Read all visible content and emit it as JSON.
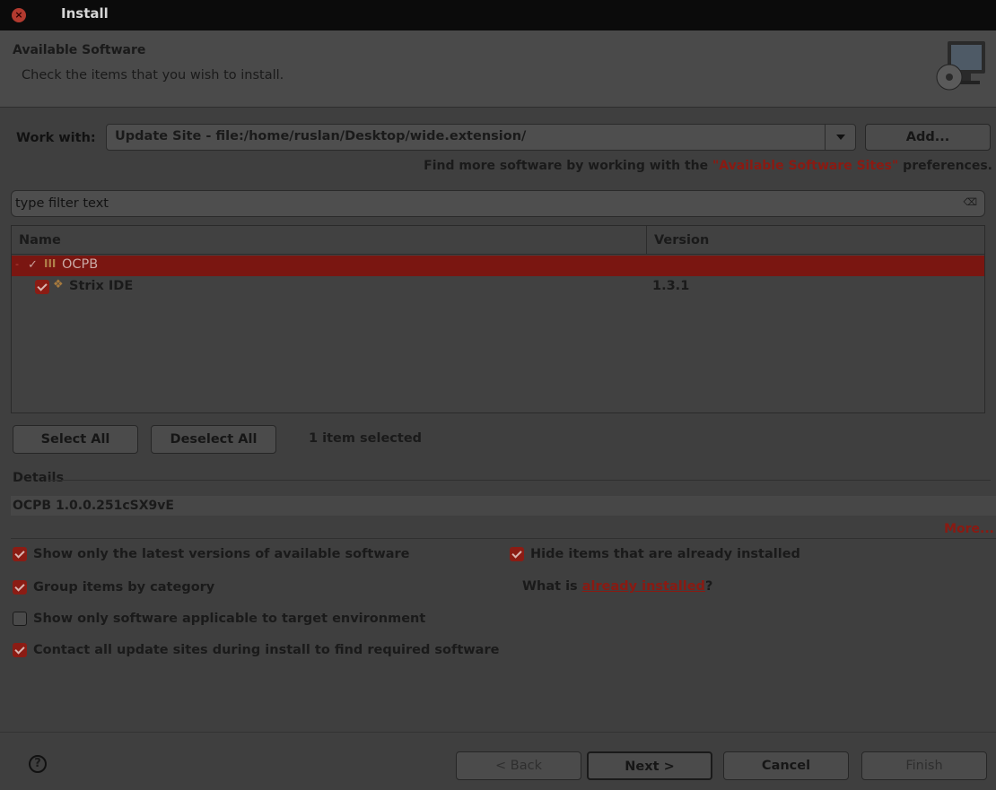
{
  "window": {
    "title": "Install"
  },
  "banner": {
    "title": "Available Software",
    "description": "Check the items that you wish to install."
  },
  "workwith": {
    "label": "Work with:",
    "value": "Update Site - file:/home/ruslan/Desktop/wide.extension/",
    "add_label": "Add...",
    "hint_prefix": "Find more software by working with the ",
    "hint_link": "\"Available Software Sites\"",
    "hint_suffix": " preferences."
  },
  "filter": {
    "placeholder": "type filter text"
  },
  "table": {
    "headers": {
      "name": "Name",
      "version": "Version"
    },
    "rows": [
      {
        "name": "OCPB",
        "version": ""
      },
      {
        "name": "Strix IDE",
        "version": "1.3.1"
      }
    ]
  },
  "selection": {
    "select_all": "Select All",
    "deselect_all": "Deselect All",
    "status": "1 item selected"
  },
  "details": {
    "legend": "Details",
    "text": "OCPB 1.0.0.251cSX9vE",
    "more": "More..."
  },
  "options": {
    "latest": "Show only the latest versions of available software",
    "group": "Group items by category",
    "target": "Show only software applicable to target environment",
    "contact": "Contact all update sites during install to find required software",
    "hide": "Hide items that are already installed",
    "what_prefix": "What is ",
    "what_link": "already installed",
    "what_suffix": "?"
  },
  "footer": {
    "help": "?",
    "back": "< Back",
    "next": "Next >",
    "cancel": "Cancel",
    "finish": "Finish"
  },
  "colors": {
    "accent": "#8b1c14",
    "selection": "#7a1611",
    "link": "#8a1a12"
  },
  "icons": {
    "close": "close-icon",
    "banner": "monitor-cd-icon",
    "clear": "clear-filter-icon"
  }
}
